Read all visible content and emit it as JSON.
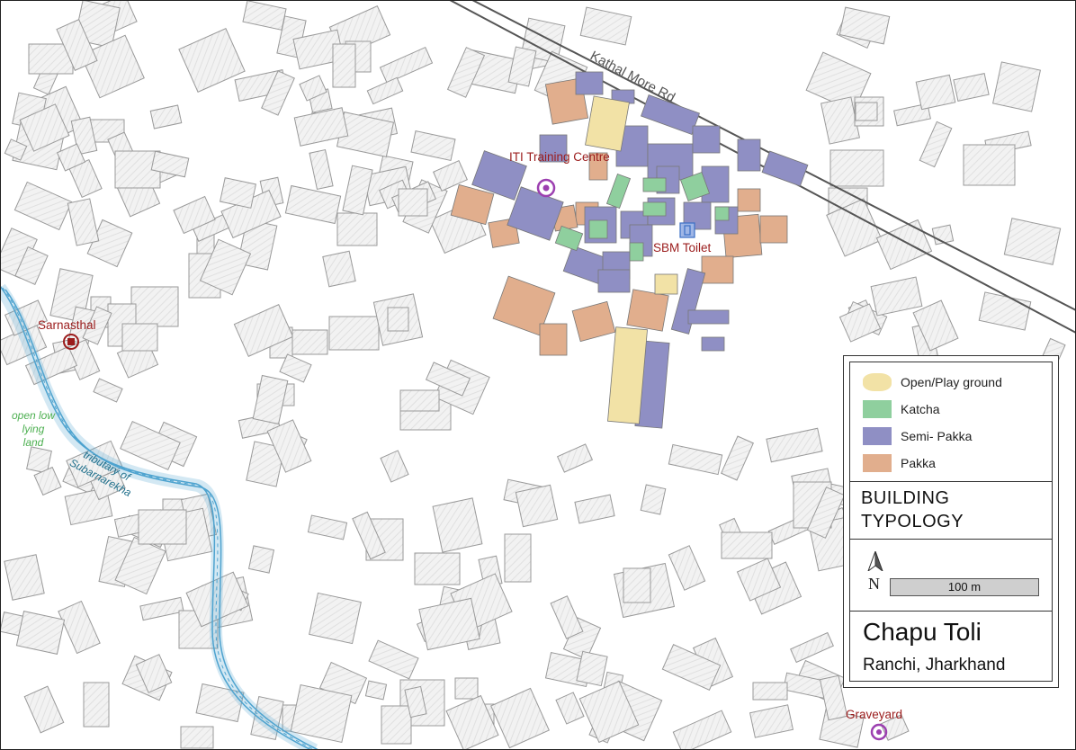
{
  "map": {
    "road_label": "Kathal More Rd",
    "river_label": "tributary of Subarnarekha",
    "land_label": "open low lying land",
    "places": [
      {
        "name": "ITI Training Centre"
      },
      {
        "name": "SBM Toilet"
      },
      {
        "name": "Sarnasthal"
      },
      {
        "name": "Graveyard"
      }
    ]
  },
  "legend": {
    "items": [
      {
        "label": "Open/Play ground",
        "color": "#f2e2a6"
      },
      {
        "label": "Katcha",
        "color": "#8fcf9e"
      },
      {
        "label": "Semi- Pakka",
        "color": "#8f8fc4"
      },
      {
        "label": "Pakka",
        "color": "#e1ae8d"
      }
    ],
    "title_line1": "BUILDING",
    "title_line2": "TYPOLOGY",
    "north": "N",
    "scale_text": "100 m"
  },
  "place": {
    "title": "Chapu Toli",
    "subtitle": "Ranchi, Jharkhand"
  },
  "colors": {
    "background_building": "#f0f0f0",
    "building_outline": "#9a9a9a",
    "water": "#4ea3cf",
    "place_label": "#9b1c1c",
    "marker_purple": "#9c3fb0"
  }
}
